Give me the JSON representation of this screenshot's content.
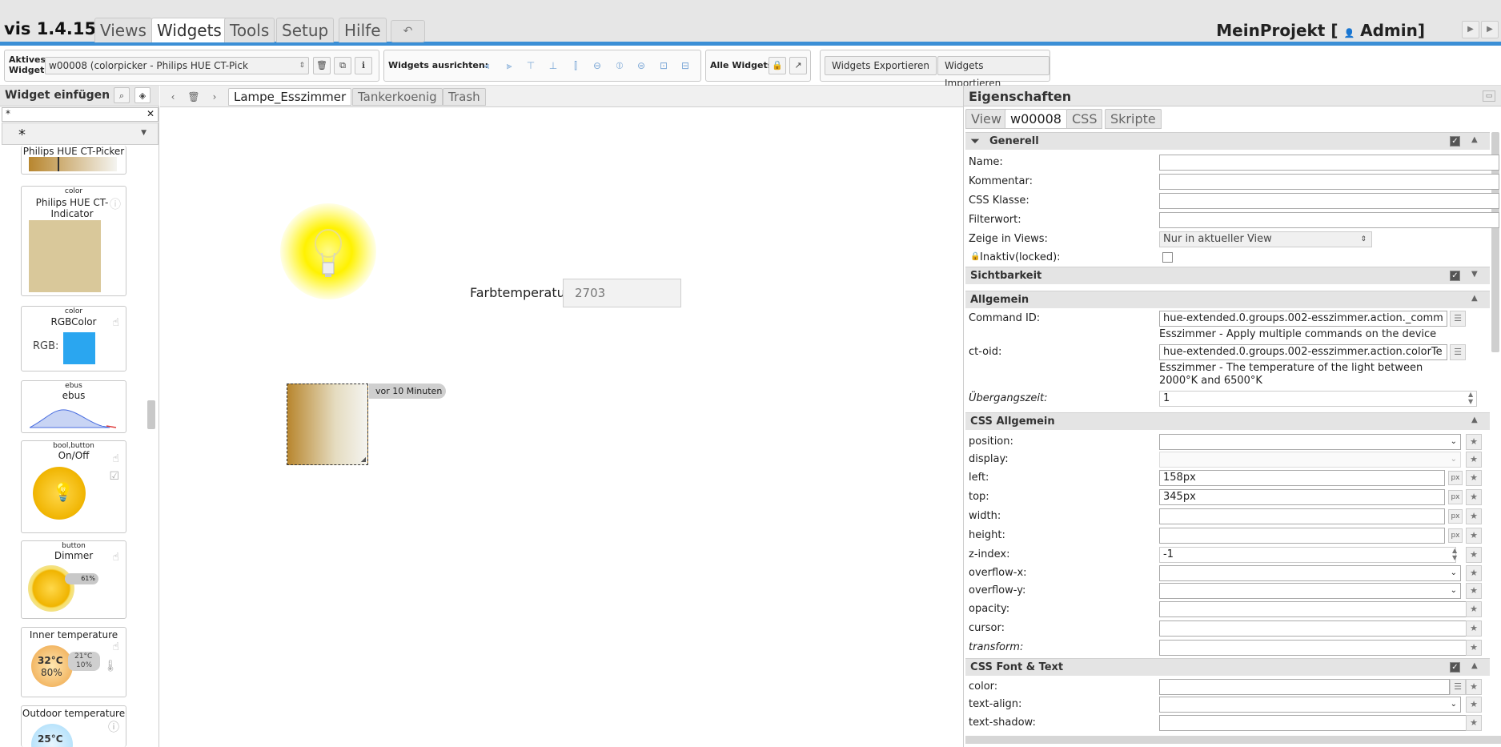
{
  "app": {
    "version": "vis 1.4.15",
    "menu_tabs": [
      "Views",
      "Widgets",
      "Tools",
      "Setup",
      "Hilfe"
    ],
    "active_menu_tab": "Widgets",
    "project": "MeinProjekt [",
    "user": "Admin]"
  },
  "toolbar": {
    "active_widget_label": "Aktives Widget:",
    "active_widget_value": "w00008 (colorpicker - Philips HUE CT-Pick",
    "align_label": "Widgets ausrichten:",
    "all_widgets_label": "Alle Widgets:",
    "export_label": "Widgets Exportieren",
    "import_label": "Widgets Importieren"
  },
  "palette": {
    "title": "Widget einfügen",
    "filter_value": "*",
    "category_value": "*",
    "cards": [
      {
        "tag": "",
        "title": "Philips HUE CT-Picker"
      },
      {
        "tag": "color",
        "title": "Philips HUE CT-Indicator"
      },
      {
        "tag": "color",
        "title": "RGBColor",
        "extra": "RGB:"
      },
      {
        "tag": "ebus",
        "title": "ebus"
      },
      {
        "tag": "bool,button",
        "title": "On/Off"
      },
      {
        "tag": "button",
        "title": "Dimmer",
        "extra": "61%"
      },
      {
        "tag": "",
        "title": "Inner temperature",
        "extra": "32°C",
        "extra2": "80%",
        "extra3": "21°C",
        "extra4": "10%"
      },
      {
        "tag": "",
        "title": "Outdoor temperature",
        "extra": "25°C"
      }
    ]
  },
  "canvas": {
    "views": [
      "Lampe_Esszimmer",
      "Tankerkoenig",
      "Trash"
    ],
    "active_view": "Lampe_Esszimmer",
    "farbtemp_label": "Farbtemperatur",
    "farbtemp_value": "2703",
    "last_change": "vor 10 Minuten"
  },
  "props": {
    "title": "Eigenschaften",
    "tabs": [
      "View",
      "w00008",
      "CSS",
      "Skripte"
    ],
    "active_tab": "w00008",
    "generell": {
      "head": "Generell",
      "name": "Name:",
      "kommentar": "Kommentar:",
      "css_klasse": "CSS Klasse:",
      "filterwort": "Filterwort:",
      "zeige": "Zeige in Views:",
      "zeige_value": "Nur in aktueller View",
      "inaktiv": "Inaktiv(locked):"
    },
    "sichtbarkeit": "Sichtbarkeit",
    "allgemein": {
      "head": "Allgemein",
      "command_label": "Command ID:",
      "command_value": "hue-extended.0.groups.002-esszimmer.action._comm",
      "command_desc": "Esszimmer - Apply multiple commands on the device",
      "ct_label": "ct-oid:",
      "ct_value": "hue-extended.0.groups.002-esszimmer.action.colorTe",
      "ct_desc": "Esszimmer - The temperature of the light between 2000°K and 6500°K",
      "uebergang_label": "Übergangszeit:",
      "uebergang_value": "1"
    },
    "css_allgemein": {
      "head": "CSS Allgemein",
      "position": "position:",
      "display": "display:",
      "left": "left:",
      "left_value": "158px",
      "top": "top:",
      "top_value": "345px",
      "width": "width:",
      "height": "height:",
      "zindex": "z-index:",
      "zindex_value": "-1",
      "overflow_x": "overflow-x:",
      "overflow_y": "overflow-y:",
      "opacity": "opacity:",
      "cursor": "cursor:",
      "transform": "transform:",
      "px": "px"
    },
    "css_font": {
      "head": "CSS Font & Text",
      "color": "color:",
      "text_align": "text-align:",
      "text_shadow": "text-shadow:"
    }
  },
  "colors": {
    "accent": "#3b8fd6",
    "bulb_glow": "#fff200",
    "ct_warm": "#b8862e",
    "ct_cold": "#f4f4f0"
  }
}
